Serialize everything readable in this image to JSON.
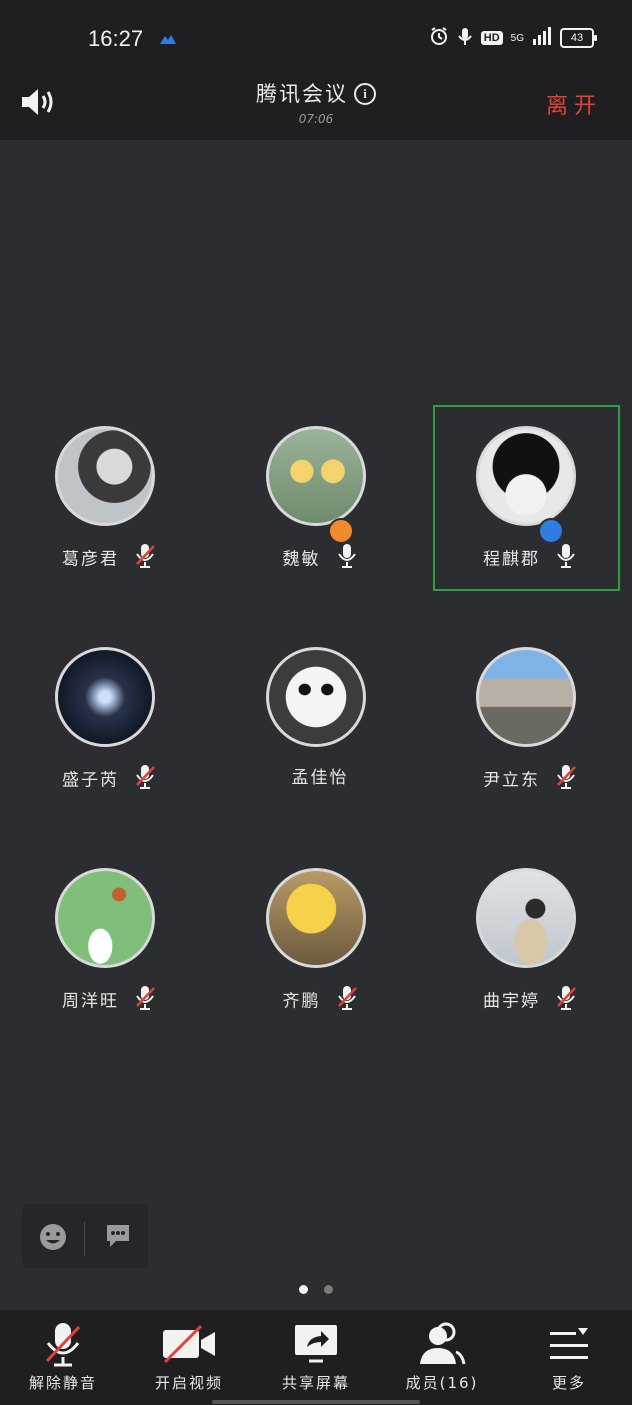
{
  "status_bar": {
    "time": "16:27",
    "hd": "HD",
    "network": "5G",
    "battery": "43"
  },
  "header": {
    "title": "腾讯会议",
    "timer": "07:06",
    "leave_label": "离开"
  },
  "participants": [
    {
      "name": "葛彦君",
      "mic": "muted"
    },
    {
      "name": "魏敏",
      "mic": "on",
      "role": "host"
    },
    {
      "name": "程麒郡",
      "mic": "on",
      "role": "cohost",
      "speaking": true
    },
    {
      "name": "盛子芮",
      "mic": "muted"
    },
    {
      "name": "孟佳怡",
      "mic": "none"
    },
    {
      "name": "尹立东",
      "mic": "muted"
    },
    {
      "name": "周洋旺",
      "mic": "muted"
    },
    {
      "name": "齐鹏",
      "mic": "muted"
    },
    {
      "name": "曲宇婷",
      "mic": "muted"
    }
  ],
  "toolbar": {
    "unmute_label": "解除静音",
    "video_label": "开启视频",
    "share_label": "共享屏幕",
    "members_label": "成员(16)",
    "more_label": "更多"
  },
  "pager": {
    "pages": 2,
    "current": 1
  },
  "colors": {
    "leave": "#e0413a",
    "active_speaker": "#2ea043",
    "host_badge": "#f08a2a",
    "cohost_badge": "#2f7de1",
    "mute_slash": "#e0413a"
  }
}
